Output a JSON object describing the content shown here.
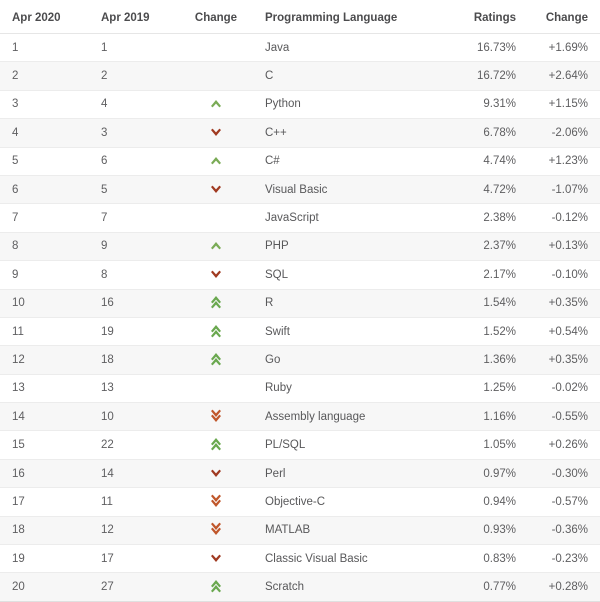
{
  "table": {
    "headers": {
      "rank_new": "Apr 2020",
      "rank_old": "Apr 2019",
      "change": "Change",
      "language": "Programming Language",
      "ratings": "Ratings",
      "delta": "Change"
    },
    "colors": {
      "up": "#7aab56",
      "down": "#a03a21",
      "double_up": "#6aa84f",
      "double_down": "#c0572b",
      "text": "#58585a",
      "header_text": "#4c4c4e",
      "row_odd_bg": "#ffffff",
      "row_even_bg": "#f7f7f7",
      "border": "#ececec"
    },
    "rows": [
      {
        "rank_new": "1",
        "rank_old": "1",
        "change": "none",
        "language": "Java",
        "ratings": "16.73%",
        "delta": "+1.69%"
      },
      {
        "rank_new": "2",
        "rank_old": "2",
        "change": "none",
        "language": "C",
        "ratings": "16.72%",
        "delta": "+2.64%"
      },
      {
        "rank_new": "3",
        "rank_old": "4",
        "change": "up",
        "language": "Python",
        "ratings": "9.31%",
        "delta": "+1.15%"
      },
      {
        "rank_new": "4",
        "rank_old": "3",
        "change": "down",
        "language": "C++",
        "ratings": "6.78%",
        "delta": "-2.06%"
      },
      {
        "rank_new": "5",
        "rank_old": "6",
        "change": "up",
        "language": "C#",
        "ratings": "4.74%",
        "delta": "+1.23%"
      },
      {
        "rank_new": "6",
        "rank_old": "5",
        "change": "down",
        "language": "Visual Basic",
        "ratings": "4.72%",
        "delta": "-1.07%"
      },
      {
        "rank_new": "7",
        "rank_old": "7",
        "change": "none",
        "language": "JavaScript",
        "ratings": "2.38%",
        "delta": "-0.12%"
      },
      {
        "rank_new": "8",
        "rank_old": "9",
        "change": "up",
        "language": "PHP",
        "ratings": "2.37%",
        "delta": "+0.13%"
      },
      {
        "rank_new": "9",
        "rank_old": "8",
        "change": "down",
        "language": "SQL",
        "ratings": "2.17%",
        "delta": "-0.10%"
      },
      {
        "rank_new": "10",
        "rank_old": "16",
        "change": "double_up",
        "language": "R",
        "ratings": "1.54%",
        "delta": "+0.35%"
      },
      {
        "rank_new": "11",
        "rank_old": "19",
        "change": "double_up",
        "language": "Swift",
        "ratings": "1.52%",
        "delta": "+0.54%"
      },
      {
        "rank_new": "12",
        "rank_old": "18",
        "change": "double_up",
        "language": "Go",
        "ratings": "1.36%",
        "delta": "+0.35%"
      },
      {
        "rank_new": "13",
        "rank_old": "13",
        "change": "none",
        "language": "Ruby",
        "ratings": "1.25%",
        "delta": "-0.02%"
      },
      {
        "rank_new": "14",
        "rank_old": "10",
        "change": "double_down",
        "language": "Assembly language",
        "ratings": "1.16%",
        "delta": "-0.55%"
      },
      {
        "rank_new": "15",
        "rank_old": "22",
        "change": "double_up",
        "language": "PL/SQL",
        "ratings": "1.05%",
        "delta": "+0.26%"
      },
      {
        "rank_new": "16",
        "rank_old": "14",
        "change": "down",
        "language": "Perl",
        "ratings": "0.97%",
        "delta": "-0.30%"
      },
      {
        "rank_new": "17",
        "rank_old": "11",
        "change": "double_down",
        "language": "Objective-C",
        "ratings": "0.94%",
        "delta": "-0.57%"
      },
      {
        "rank_new": "18",
        "rank_old": "12",
        "change": "double_down",
        "language": "MATLAB",
        "ratings": "0.93%",
        "delta": "-0.36%"
      },
      {
        "rank_new": "19",
        "rank_old": "17",
        "change": "down",
        "language": "Classic Visual Basic",
        "ratings": "0.83%",
        "delta": "-0.23%"
      },
      {
        "rank_new": "20",
        "rank_old": "27",
        "change": "double_up",
        "language": "Scratch",
        "ratings": "0.77%",
        "delta": "+0.28%"
      }
    ]
  }
}
